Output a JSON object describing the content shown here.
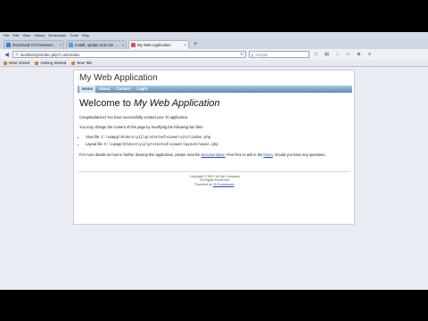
{
  "menubar": [
    "File",
    "Edit",
    "View",
    "History",
    "Bookmarks",
    "Tools",
    "Help"
  ],
  "tabs": [
    {
      "label": "Download Yii Framework | PH...",
      "active": false,
      "icon_color": "#3a7bd5"
    },
    {
      "label": "Install, update and use Wi...",
      "active": false,
      "icon_color": "#5b9bd5"
    },
    {
      "label": "My Web Application",
      "active": true,
      "icon_color": "#d9534f"
    }
  ],
  "navbar": {
    "url": "localhost/yii/index.php?r=site/index",
    "search_placeholder": "Google"
  },
  "bookmarks": [
    "Most Visited",
    "Getting Started",
    "New Tab"
  ],
  "app": {
    "title": "My Web Application",
    "menu": [
      "Home",
      "About",
      "Contact",
      "Login"
    ],
    "active_menu": "Home",
    "heading_prefix": "Welcome to ",
    "heading_name": "My Web Application",
    "congrats": "Congratulations! You have successfully created your Yii application.",
    "change_text": "You may change the content of this page by modifying the following two files:",
    "view_file_label": "View file: ",
    "view_file_path": "C:\\xampp\\htdocs\\yii\\protected\\views\\site\\index.php",
    "layout_file_label": "Layout file: ",
    "layout_file_path": "C:\\xampp\\htdocs\\yii\\protected\\views\\layouts\\main.php",
    "details_pre": "For more details on how to further develop this application, please read the ",
    "details_link1": "documentation",
    "details_mid": ". Feel free to ask in the ",
    "details_link2": "forum",
    "details_post": ", should you have any questions.",
    "footer_copyright": "Copyright © 2017 by My Company.",
    "footer_rights": "All Rights Reserved.",
    "footer_powered_pre": "Powered by ",
    "footer_powered_link": "Yii Framework",
    "footer_powered_post": "."
  }
}
